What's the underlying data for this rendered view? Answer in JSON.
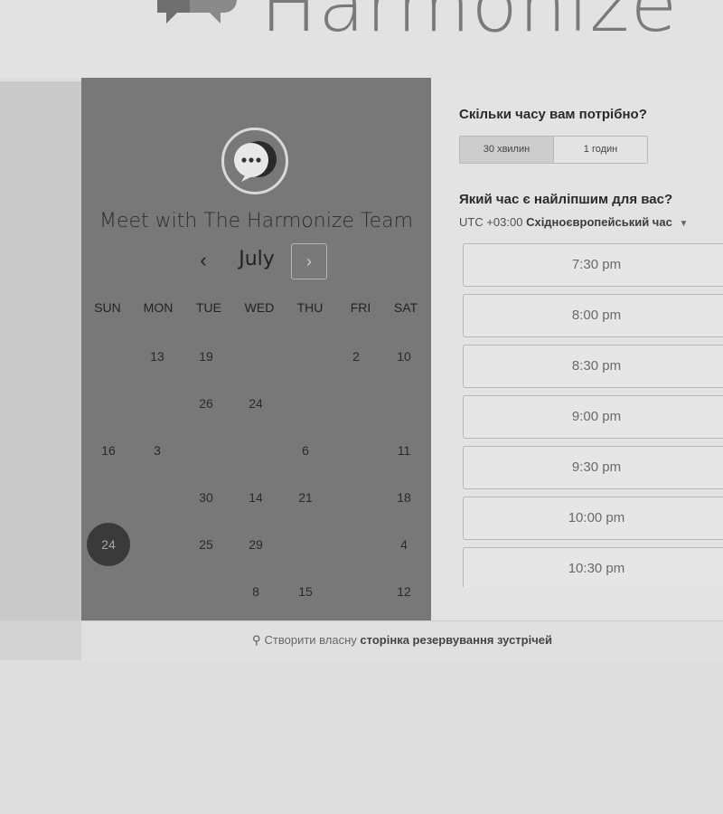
{
  "brand": {
    "name": "Harmonize"
  },
  "calendar": {
    "title": "Meet with The Harmonize Team",
    "prev_label": "‹",
    "next_label": "›",
    "month": "July",
    "weekdays": [
      "SUN",
      "MON",
      "TUE",
      "WED",
      "THU",
      "FRI",
      "SAT"
    ],
    "rows": [
      [
        "",
        "13",
        "19",
        "",
        "",
        "2",
        "10"
      ],
      [
        "",
        "",
        "26",
        "24",
        "",
        "",
        ""
      ],
      [
        "16",
        "3",
        "",
        "",
        "6",
        "",
        "11"
      ],
      [
        "",
        "",
        "30",
        "14",
        "21",
        "",
        "18"
      ],
      [
        "24",
        "",
        "25",
        "29",
        "",
        "",
        "4"
      ],
      [
        "",
        "",
        "",
        "8",
        "15",
        "",
        "12"
      ]
    ],
    "selected_day": "24"
  },
  "booking": {
    "duration_question": "Скільки часу вам потрібно?",
    "durations": [
      "30 хвилин",
      "1 годин"
    ],
    "selected_duration": "30 хвилин",
    "time_question": "Який час є найліпшим для вас?",
    "timezone_offset": "UTC +03:00",
    "timezone_name": "Східноєвропейський час",
    "slots": [
      "7:30 pm",
      "8:00 pm",
      "8:30 pm",
      "9:00 pm",
      "9:30 pm",
      "10:00 pm",
      "10:30 pm"
    ]
  },
  "footer": {
    "text_plain": "Створити власну",
    "text_bold": "сторінка резервування зустрічей"
  },
  "colors": {
    "calendar_bg": "#787878",
    "selected_day_bg": "#3a3a3a",
    "panel_bg": "#e3e3e3"
  }
}
